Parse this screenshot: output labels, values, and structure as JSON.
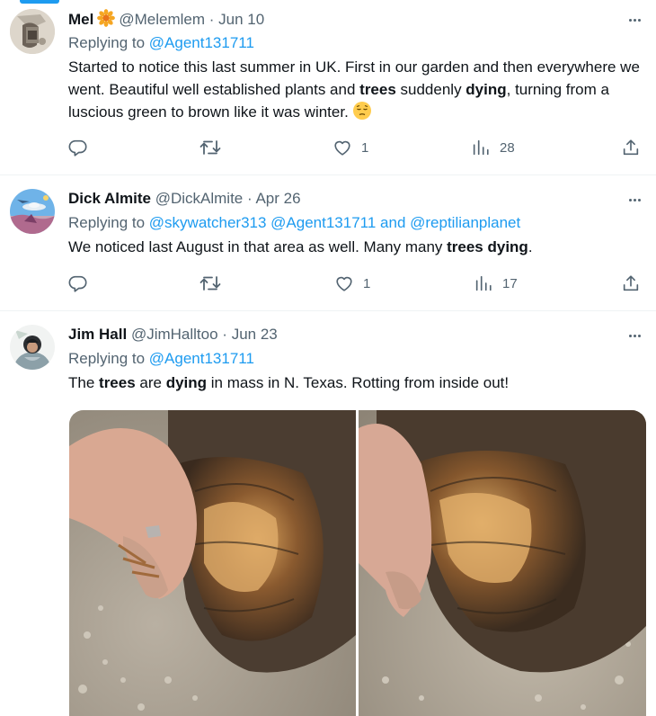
{
  "tweets": [
    {
      "name": "Mel",
      "handle": "@Melemlem",
      "sep": "·",
      "date": "Jun 10",
      "replying_prefix": "Replying to",
      "mentions": [
        "@Agent131711"
      ],
      "text_parts": [
        "Started to notice this last summer in UK. First in our garden and then everywhere we went. Beautiful well established plants and ",
        "trees",
        " suddenly ",
        "dying",
        ", turning from a luscious green to brown like it was winter."
      ],
      "counts": {
        "replies": "",
        "retweets": "",
        "likes": "1",
        "views": "28"
      }
    },
    {
      "name": "Dick Almite",
      "handle": "@DickAlmite",
      "sep": "·",
      "date": "Apr 26",
      "replying_prefix": "Replying to",
      "mentions": [
        "@skywatcher313 @Agent131711 and @reptilianplanet"
      ],
      "text_parts": [
        "We noticed last August in that area as well. Many many ",
        "trees dying",
        "."
      ],
      "counts": {
        "replies": "",
        "retweets": "",
        "likes": "1",
        "views": "17"
      }
    },
    {
      "name": "Jim Hall",
      "handle": "@JimHalltoo",
      "sep": "·",
      "date": "Jun 23",
      "replying_prefix": "Replying to",
      "mentions": [
        "@Agent131711"
      ],
      "text_parts": [
        "The ",
        "trees",
        " are ",
        "dying",
        " in mass in N. Texas. Rotting from inside out!"
      ]
    }
  ],
  "icons": {
    "reply": "reply-icon",
    "retweet": "retweet-icon",
    "like": "heart-icon",
    "views": "views-icon",
    "share": "share-icon",
    "more": "more-icon"
  },
  "colors": {
    "accent": "#1d9bf0",
    "text": "#0f1419",
    "muted": "#536471",
    "separator": "#eff3f4"
  }
}
